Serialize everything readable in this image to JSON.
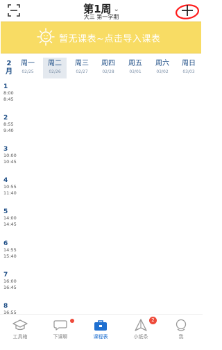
{
  "header": {
    "week_label": "第1周",
    "term_label": "大三 第一学期",
    "annotation_color": "#ff1a1a"
  },
  "banner": {
    "text": "暂无课表~点击导入课表",
    "background": "#f8dc64"
  },
  "calendar": {
    "month_number": "2",
    "month_char": "月",
    "days": [
      {
        "name": "周一",
        "date": "02/25",
        "selected": false
      },
      {
        "name": "周二",
        "date": "02/26",
        "selected": true
      },
      {
        "name": "周三",
        "date": "02/27",
        "selected": false
      },
      {
        "name": "周四",
        "date": "02/28",
        "selected": false
      },
      {
        "name": "周五",
        "date": "03/01",
        "selected": false
      },
      {
        "name": "周六",
        "date": "03/02",
        "selected": false
      },
      {
        "name": "周日",
        "date": "03/03",
        "selected": false
      }
    ]
  },
  "periods": [
    {
      "num": "1",
      "start": "8:00",
      "end": "8:45"
    },
    {
      "num": "2",
      "start": "8:55",
      "end": "9:40"
    },
    {
      "num": "3",
      "start": "10:00",
      "end": "10:45"
    },
    {
      "num": "4",
      "start": "10:55",
      "end": "11:40"
    },
    {
      "num": "5",
      "start": "14:00",
      "end": "14:45"
    },
    {
      "num": "6",
      "start": "14:55",
      "end": "15:40"
    },
    {
      "num": "7",
      "start": "16:00",
      "end": "16:45"
    },
    {
      "num": "8",
      "start": "16:55",
      "end": ""
    }
  ],
  "tabs": [
    {
      "label": "工具箱",
      "icon": "graduation-cap-icon"
    },
    {
      "label": "下课聊",
      "icon": "chat-bubble-icon"
    },
    {
      "label": "课程表",
      "icon": "briefcase-icon"
    },
    {
      "label": "小纸条",
      "icon": "paper-plane-icon",
      "badge": "2"
    },
    {
      "label": "我",
      "icon": "profile-icon"
    }
  ],
  "colors": {
    "accent": "#1e6fd0",
    "text_blue": "#1e4e86",
    "badge_red": "#ee4a3a"
  }
}
